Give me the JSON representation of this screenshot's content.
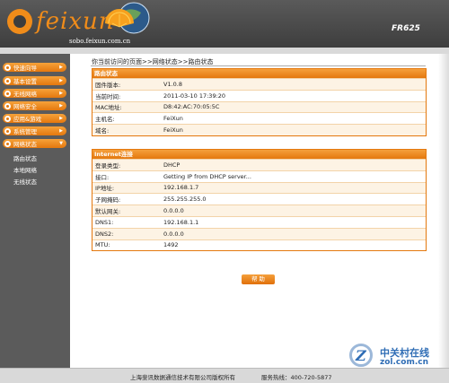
{
  "header": {
    "brand": "feixun",
    "url": "sobo.feixun.com.cn",
    "model": "FR625"
  },
  "sidebar": {
    "items": [
      {
        "label": "快速向导"
      },
      {
        "label": "基本设置"
      },
      {
        "label": "无线网络"
      },
      {
        "label": "网络安全"
      },
      {
        "label": "应用&游戏"
      },
      {
        "label": "系统管理"
      },
      {
        "label": "网络状态"
      }
    ],
    "sub_items": [
      {
        "label": "路由状态"
      },
      {
        "label": "本地网络"
      },
      {
        "label": "无线状态"
      }
    ]
  },
  "breadcrumb": "你当前访问的页面>>网络状态>>路由状态",
  "router_status": {
    "title": "路由状态",
    "rows": [
      {
        "label": "固件版本:",
        "value": "V1.0.8"
      },
      {
        "label": "当前时间:",
        "value": "2011-03-10 17:39:20"
      },
      {
        "label": "MAC地址:",
        "value": "D8:42:AC:70:05:5C"
      },
      {
        "label": "主机名:",
        "value": "FeiXun"
      },
      {
        "label": "域名:",
        "value": "FeiXun"
      }
    ]
  },
  "internet": {
    "title": "Internet连接",
    "rows": [
      {
        "label": "登录类型:",
        "value": "DHCP"
      },
      {
        "label": "接口:",
        "value": "Getting IP from DHCP server..."
      },
      {
        "label": "IP地址:",
        "value": "192.168.1.7"
      },
      {
        "label": "子网掩码:",
        "value": "255.255.255.0"
      },
      {
        "label": "默认网关:",
        "value": "0.0.0.0"
      },
      {
        "label": "DNS1:",
        "value": "192.168.1.1"
      },
      {
        "label": "DNS2:",
        "value": "0.0.0.0"
      },
      {
        "label": "MTU:",
        "value": "1492"
      }
    ]
  },
  "help_button": "帮 助",
  "footer": {
    "company": "上海斐讯数据通信技术有限公司",
    "rights": "版权所有",
    "hotline": "服务热线：400-720-5877"
  },
  "watermark": {
    "cn": "中关村在线",
    "en": "zol.com.cn"
  },
  "colors": {
    "accent": "#e4780e",
    "sidebar": "#5b5b5b",
    "header": "#444444"
  }
}
